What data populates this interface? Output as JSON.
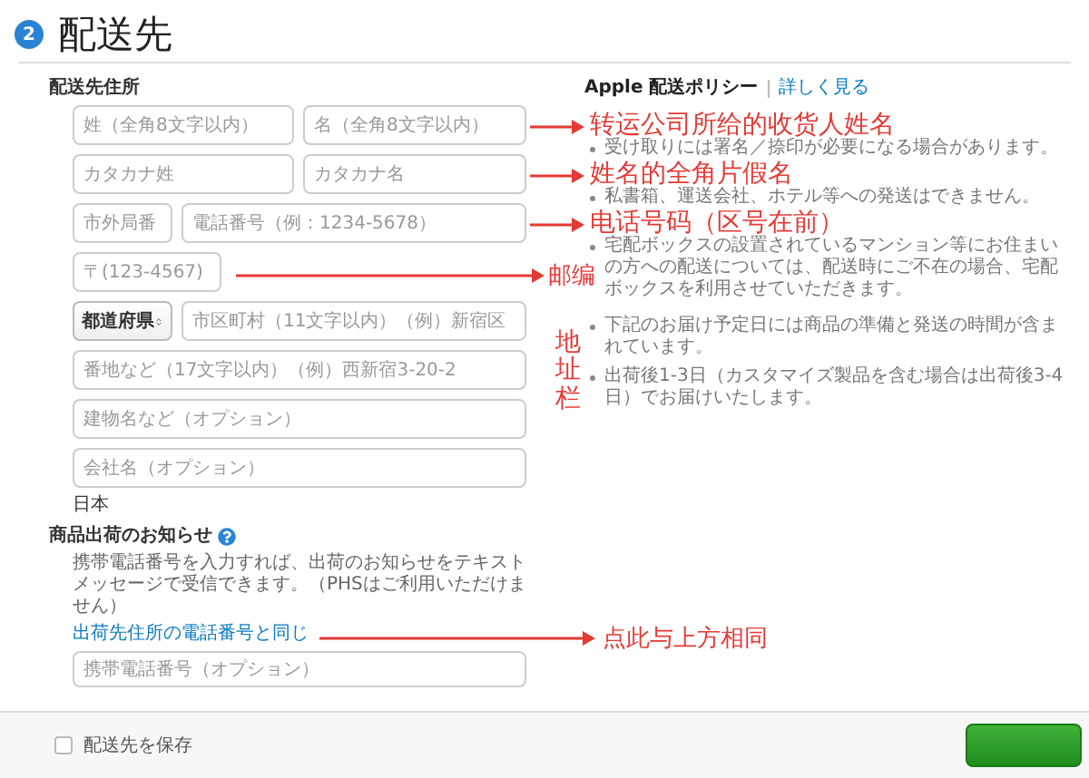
{
  "step": {
    "number": "2",
    "title": "配送先"
  },
  "address": {
    "heading": "配送先住所",
    "rows": [
      [
        {
          "kind": "text",
          "placeholder": "姓（全角8文字以内）"
        },
        {
          "kind": "text",
          "placeholder": "名（全角8文字以内）"
        }
      ],
      [
        {
          "kind": "text",
          "placeholder": "カタカナ姓"
        },
        {
          "kind": "text",
          "placeholder": "カタカナ名"
        }
      ],
      [
        {
          "kind": "text",
          "placeholder": "市外局番"
        },
        {
          "kind": "text",
          "placeholder": "電話番号（例：1234-5678）"
        }
      ],
      [
        {
          "kind": "text",
          "placeholder": "〒(123-4567)"
        }
      ],
      [
        {
          "kind": "select",
          "value": "都道府県"
        },
        {
          "kind": "text",
          "placeholder": "市区町村（11文字以内）（例）新宿区"
        }
      ],
      [
        {
          "kind": "text",
          "placeholder": "番地など（17文字以内）（例）西新宿3-20-2"
        }
      ],
      [
        {
          "kind": "text",
          "placeholder": "建物名など（オプション）"
        }
      ],
      [
        {
          "kind": "text",
          "placeholder": "会社名（オプション）"
        }
      ]
    ],
    "country": "日本"
  },
  "notice": {
    "heading": "商品出荷のお知らせ",
    "text": "携帯電話番号を入力すれば、出荷のお知らせをテキストメッセージで受信できます。（PHSはご利用いただけません）",
    "link": "出荷先住所の電話番号と同じ",
    "placeholder": "携帯電話番号（オプション）"
  },
  "policy": {
    "title": "Apple 配送ポリシー",
    "link": "詳しく見る",
    "bullets": [
      "受け取りには署名／捺印が必要になる場合があります。",
      "私書箱、運送会社、ホテル等への発送はできません。",
      "宅配ボックスの設置されているマンション等にお住まいの方への配送については、配送時にご不在の場合、宅配ボックスを利用させていただきます。",
      "下記のお届け予定日には商品の準備と発送の時間が含まれています。",
      "出荷後1-3日（カスタマイズ製品を含む場合は出荷後3-4日）でお届けいたします。"
    ]
  },
  "annotations": [
    {
      "kind": "arrow",
      "text": "转运公司所给的收货人姓名"
    },
    {
      "kind": "arrow",
      "text": "姓名的全角片假名"
    },
    {
      "kind": "arrow",
      "text": "电话号码（区号在前）"
    },
    {
      "kind": "arrow",
      "text": "邮编"
    },
    {
      "kind": "vertical",
      "text": "地址栏"
    },
    {
      "kind": "arrow",
      "text": "点此与上方相同"
    }
  ],
  "footer": {
    "save": {
      "label": "配送先を保存",
      "checked": false
    }
  }
}
